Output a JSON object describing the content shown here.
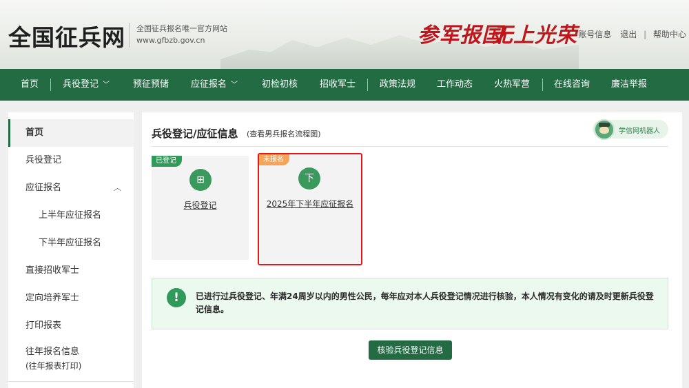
{
  "header": {
    "site_title": "全国征兵网",
    "subtitle": "全国征兵报名唯一官方网站",
    "url": "www.gfbzb.gov.cn",
    "slogan_1": "参军报国",
    "slogan_2": "无上光荣",
    "links": {
      "account": "账号信息",
      "logout": "退出",
      "help": "帮助中心"
    }
  },
  "nav": {
    "items": [
      "首页",
      "兵役登记",
      "预征预储",
      "应征报名",
      "初检初核",
      "招收军士",
      "政策法规",
      "工作动态",
      "火热军营",
      "在线咨询",
      "廉洁举报"
    ],
    "chevron": "﹀"
  },
  "sidebar": {
    "items": [
      "首页",
      "兵役登记",
      "应征报名",
      "上半年应征报名",
      "下半年应征报名",
      "直接招收军士",
      "定向培养军士",
      "打印报表",
      "往年报名信息",
      "(往年报表打印)"
    ],
    "chevron_up": "︿"
  },
  "main": {
    "title": "兵役登记/应征信息",
    "flow_link": "(查看男兵报名流程图)",
    "robot_label": "学信网机器人",
    "cards": [
      {
        "badge": "已登记",
        "label": "兵役登记",
        "icon": "registration-icon",
        "icon_glyph": "⊞"
      },
      {
        "badge": "未报名",
        "label": "2025年下半年应征报名",
        "icon": "download-form-icon",
        "icon_glyph": "下"
      }
    ],
    "notice": "已进行过兵役登记、年满24周岁以内的男性公民，每年应对本人兵役登记情况进行核验，本人情况有变化的请及时更新兵役登记信息。",
    "notice_icon": "!",
    "verify_button": "核验兵役登记信息"
  },
  "colors": {
    "brand_green": "#226b43",
    "accent_red": "#c0161b",
    "highlight_red": "#e1191b",
    "badge_orange": "#f5a45a"
  }
}
